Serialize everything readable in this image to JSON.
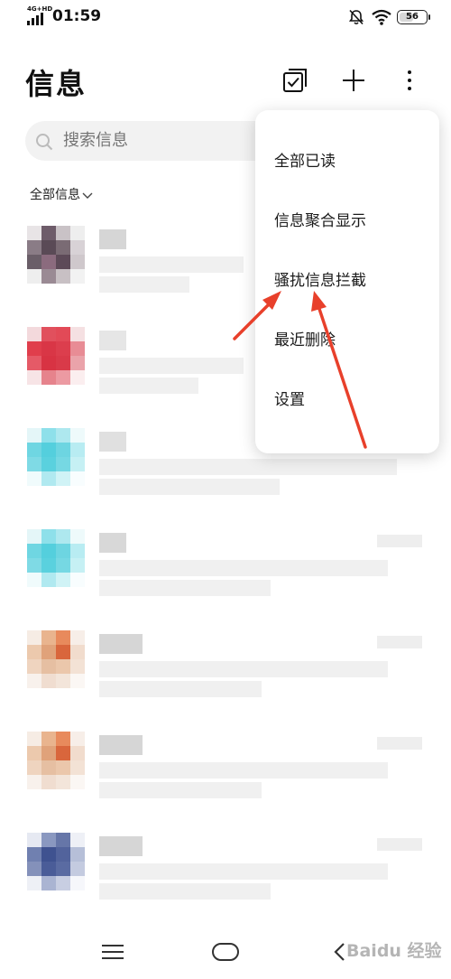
{
  "status_bar": {
    "network": "4G+HD",
    "time": "01:59",
    "battery": "56",
    "battery_level": 0.56
  },
  "header": {
    "title": "信息"
  },
  "search": {
    "placeholder": "搜索信息"
  },
  "filter": {
    "label": "全部信息"
  },
  "menu": {
    "items": [
      {
        "label": "全部已读"
      },
      {
        "label": "信息聚合显示"
      },
      {
        "label": "骚扰信息拦截"
      },
      {
        "label": "最近删除"
      },
      {
        "label": "设置"
      }
    ]
  },
  "watermark": {
    "text": "Baidu 经验"
  },
  "colors": {
    "annotation_arrow": "#e8402b",
    "menu_background": "#ffffff",
    "search_background": "#f2f2f2"
  }
}
